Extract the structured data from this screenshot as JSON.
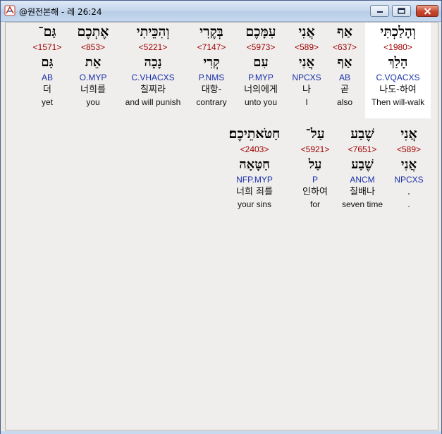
{
  "window": {
    "title": "@원전본해 - 레 26:24",
    "minimize_symbol": "‒",
    "maximize_symbol": "□",
    "close_symbol": "✕"
  },
  "verse": {
    "rows": [
      {
        "words": [
          {
            "hebrew": "וְהָלַכְתִּי",
            "strong": "<1980>",
            "root": "הָלַךְ",
            "morph": "C.VQACXS",
            "korean": "나도-하여",
            "english": "Then will-walk",
            "highlighted": true
          },
          {
            "hebrew": "אַף",
            "strong": "<637>",
            "root": "אַף",
            "morph": "AB",
            "korean": "곧",
            "english": "also"
          },
          {
            "hebrew": "אֲנִי",
            "strong": "<589>",
            "root": "אֲנִי",
            "morph": "NPCXS",
            "korean": "나",
            "english": "I"
          },
          {
            "hebrew": "עִמָּכֶם",
            "strong": "<5973>",
            "root": "עִם",
            "morph": "P.MYP",
            "korean": "너의에게",
            "english": "unto you"
          },
          {
            "hebrew": "בְּקֶרִי",
            "strong": "<7147>",
            "root": "קְרִי",
            "morph": "P.NMS",
            "korean": "대항-",
            "english": "contrary"
          },
          {
            "hebrew": "וְהִכֵּיתִי",
            "strong": "<5221>",
            "root": "נָכָה",
            "morph": "C.VHACXS",
            "korean": "칠찌라",
            "english": "and will punish"
          },
          {
            "hebrew": "אֶתְכֶם",
            "strong": "<853>",
            "root": "אֵת",
            "morph": "O.MYP",
            "korean": "너희를",
            "english": "you"
          },
          {
            "hebrew": "גַּם־",
            "strong": "<1571>",
            "root": "גַּם",
            "morph": "AB",
            "korean": "더",
            "english": "yet"
          }
        ]
      },
      {
        "words": [
          {
            "hebrew": "אֲנִי",
            "strong": "<589>",
            "root": "אֲנִי",
            "morph": "NPCXS",
            "korean": ".",
            "english": "."
          },
          {
            "hebrew": "שֶׁבַע",
            "strong": "<7651>",
            "root": "שֶׁבַע",
            "morph": "ANCM",
            "korean": "칠배나",
            "english": "seven time"
          },
          {
            "hebrew": "עַל־",
            "strong": "<5921>",
            "root": "עַל",
            "morph": "P",
            "korean": "인하여",
            "english": "for"
          },
          {
            "hebrew": "חַטֹּאתֵיכֶם׃",
            "strong": "<2403>",
            "root": "חַטָּאָה",
            "morph": "NFP.MYP",
            "korean": "너희 죄를",
            "english": "your sins"
          }
        ]
      }
    ]
  }
}
